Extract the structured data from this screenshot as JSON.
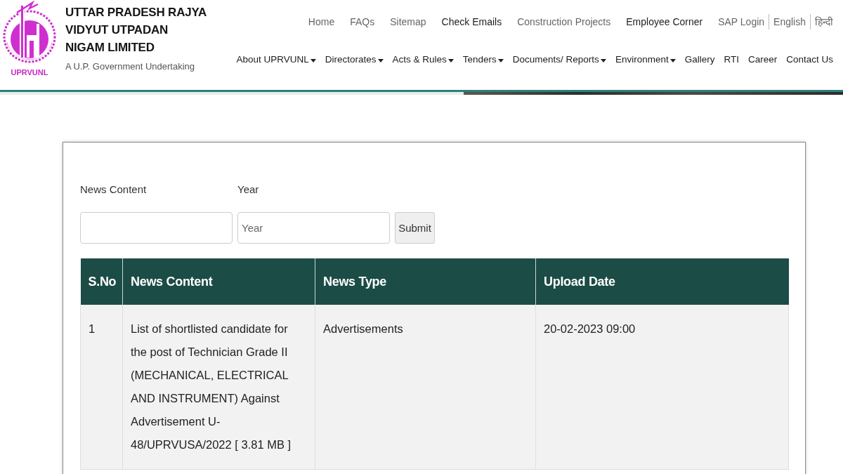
{
  "header": {
    "logo_text": "UPRVUNL",
    "title_lines": [
      "UTTAR PRADESH RAJYA",
      "VIDYUT UTPADAN",
      "NIGAM LIMITED"
    ],
    "subtitle": "A U.P. Government Undertaking"
  },
  "top_nav": [
    {
      "label": "Home",
      "kind": "link",
      "emphasized": false
    },
    {
      "label": "FAQs",
      "kind": "link",
      "emphasized": false
    },
    {
      "label": "Sitemap",
      "kind": "link",
      "emphasized": false
    },
    {
      "label": "Check Emails",
      "kind": "link",
      "emphasized": true
    },
    {
      "label": "Construction Projects",
      "kind": "link",
      "emphasized": false
    },
    {
      "label": "Employee Corner",
      "kind": "link",
      "emphasized": true
    },
    {
      "label": "SAP Login",
      "kind": "link",
      "emphasized": false
    },
    {
      "label": "English",
      "kind": "language",
      "emphasized": false
    },
    {
      "label": "हिन्दी",
      "kind": "language",
      "emphasized": false
    }
  ],
  "main_nav": [
    {
      "label": "About UPRVUNL",
      "has_dropdown": true
    },
    {
      "label": "Directorates",
      "has_dropdown": true
    },
    {
      "label": "Acts & Rules",
      "has_dropdown": true
    },
    {
      "label": "Tenders",
      "has_dropdown": true
    },
    {
      "label": "Documents/ Reports",
      "has_dropdown": true
    },
    {
      "label": "Environment",
      "has_dropdown": true
    },
    {
      "label": "Gallery",
      "has_dropdown": false
    },
    {
      "label": "RTI",
      "has_dropdown": false
    },
    {
      "label": "Career",
      "has_dropdown": false
    },
    {
      "label": "Contact Us",
      "has_dropdown": false
    }
  ],
  "search_form": {
    "fields": [
      {
        "label": "News Content"
      },
      {
        "label": "Year",
        "placeholder": "Year"
      }
    ],
    "submit_button": "Submit"
  },
  "table": {
    "columns": [
      "S.No",
      "News Content",
      "News Type",
      "Upload Date"
    ],
    "rows": [
      [
        "1",
        "List of shortlisted candidate for the post of Technician Grade II (MECHANICAL, ELECTRICAL AND INSTRUMENT) Against Advertisement U-48/UPRVUSA/2022 [ 3.81 MB ]",
        "Advertisements",
        "20-02-2023 09:00"
      ]
    ]
  }
}
